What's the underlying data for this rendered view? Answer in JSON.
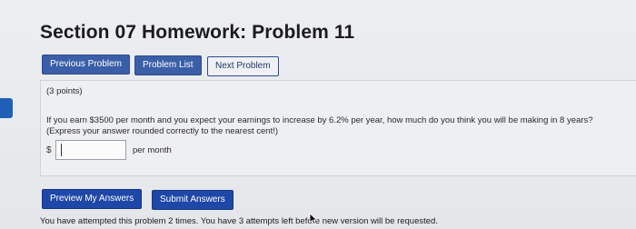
{
  "page": {
    "title": "Section 07 Homework: Problem 11"
  },
  "nav": {
    "previous": "Previous Problem",
    "list": "Problem List",
    "next": "Next Problem"
  },
  "problem": {
    "points": "(3 points)",
    "question_line1": "If you earn $3500 per month and you expect your earnings to increase by 6.2% per year, how much do you think you will be making in 8 years?",
    "question_line2": "(Express your answer rounded correctly to the nearest cent!)",
    "currency_symbol": "$",
    "answer_value": "",
    "unit_label": "per month"
  },
  "actions": {
    "preview": "Preview My Answers",
    "submit": "Submit Answers"
  },
  "status": {
    "attempts": "You have attempted this problem 2 times. You have 3 attempts left before new version will be requested."
  },
  "colors": {
    "button_blue": "#3b5ea8",
    "left_tab": "#1f5fb8"
  },
  "icons": {
    "mouse_cursor": "arrow-cursor-icon"
  }
}
